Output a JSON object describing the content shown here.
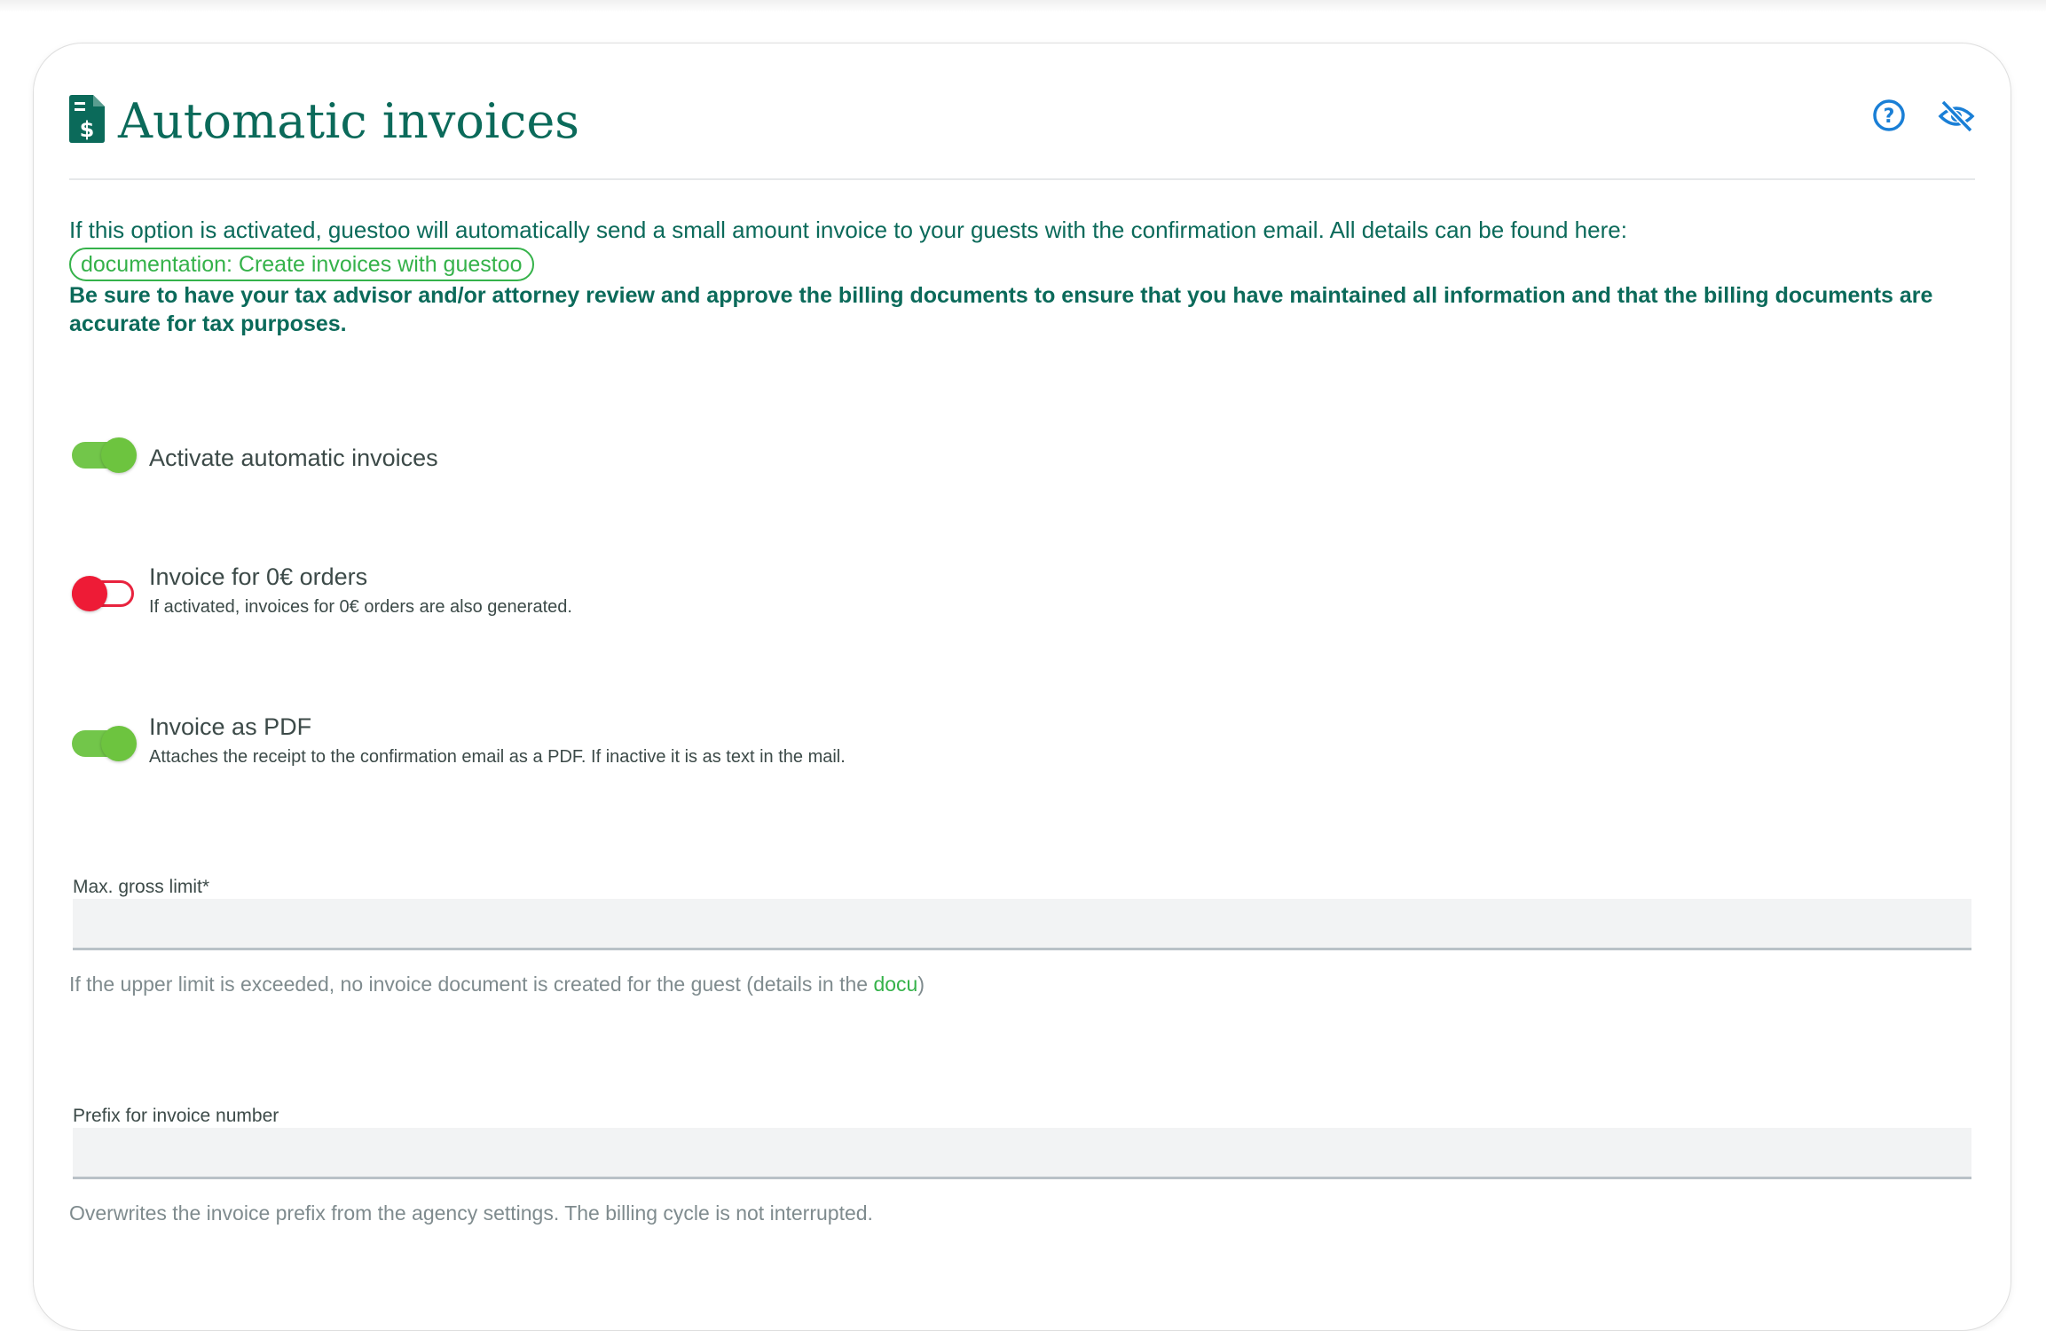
{
  "header": {
    "title": "Automatic invoices",
    "icons": [
      "invoice-dollar-icon",
      "help-circle-icon",
      "eye-slash-icon"
    ]
  },
  "intro": {
    "text": "If this option is activated, guestoo will automatically send a small amount invoice to your guests with the confirmation email. All details can be found here:",
    "doc_link": "documentation: Create invoices with guestoo",
    "warning": "Be sure to have your tax advisor and/or attorney review and approve the billing documents to ensure that you have maintained all information and that the billing documents are accurate for tax purposes."
  },
  "toggles": [
    {
      "label": "Activate automatic invoices",
      "help": "",
      "state": "on"
    },
    {
      "label": "Invoice for 0€ orders",
      "help": "If activated, invoices for 0€ orders are also generated.",
      "state": "off"
    },
    {
      "label": "Invoice as PDF",
      "help": "Attaches the receipt to the confirmation email as a PDF. If inactive it is as text in the mail.",
      "state": "on"
    }
  ],
  "fields": [
    {
      "label": "Max. gross limit*",
      "value": "",
      "help_before": "If the upper limit is exceeded, no invoice document is created for the guest (details in the ",
      "help_link": "docu",
      "help_after": ")"
    },
    {
      "label": "Prefix for invoice number",
      "value": "",
      "help": "Overwrites the invoice prefix from the agency settings. The billing cycle is not interrupted."
    }
  ],
  "colors": {
    "primary_text": "#0b6a5a",
    "link_green": "#35b24a",
    "toggle_on": "#6dc43f",
    "toggle_off": "#ee1b36",
    "icon_blue": "#1a7fd6"
  }
}
